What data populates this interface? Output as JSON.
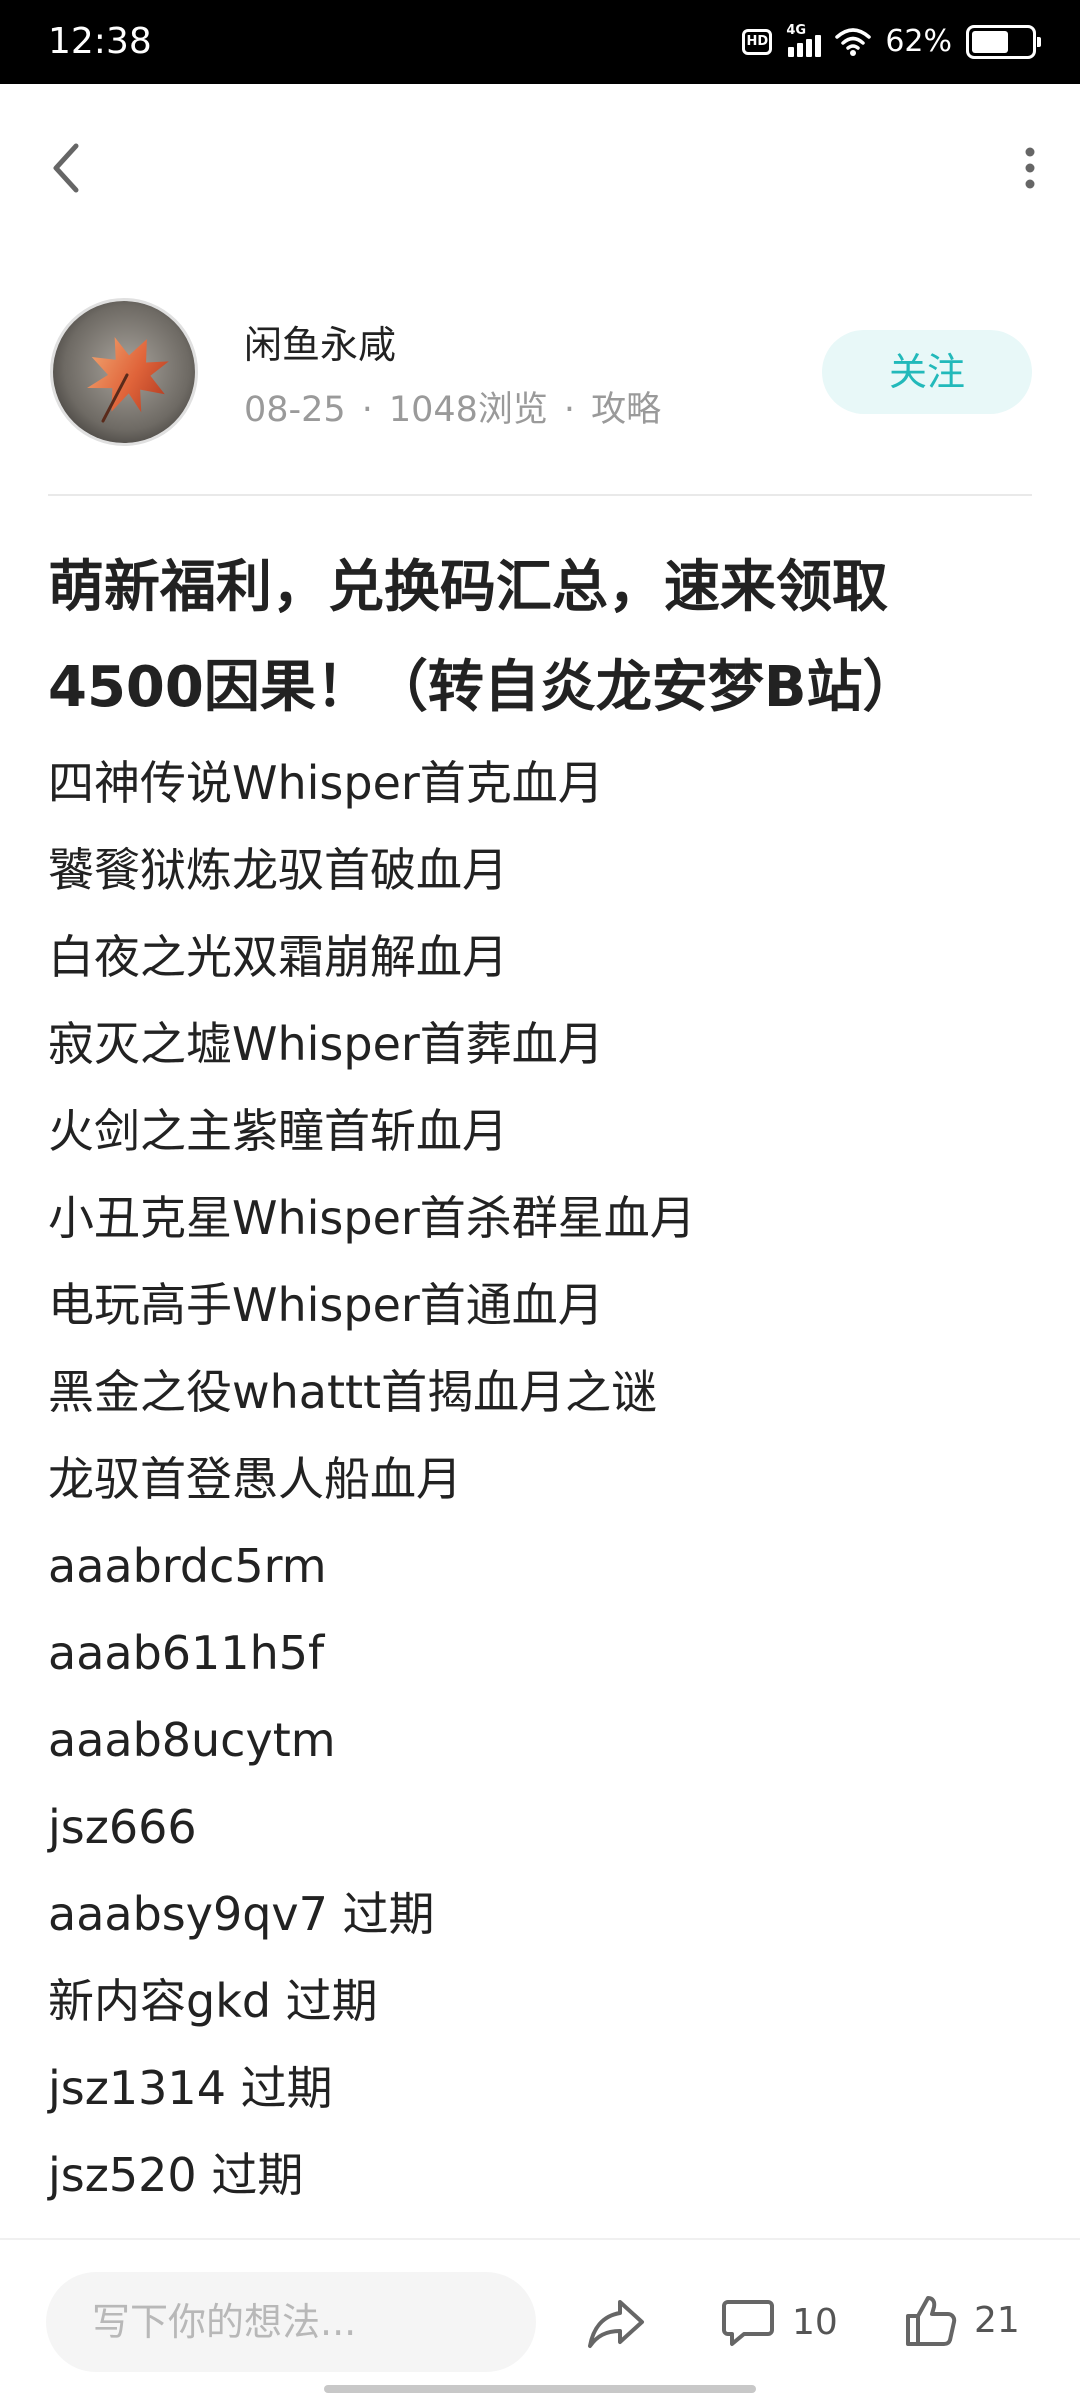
{
  "status_bar": {
    "time": "12:38",
    "hd": "HD",
    "network": "4G",
    "battery_percent": "62%",
    "battery_level": 0.62
  },
  "header": {
    "back_icon": "chevron-left-icon",
    "more_icon": "more-vertical-icon"
  },
  "author": {
    "name": "闲鱼永咸",
    "date": "08-25",
    "views": "1048浏览",
    "category": "攻略",
    "separator": "·",
    "follow_label": "关注"
  },
  "post": {
    "title": "萌新福利，兑换码汇总，速来领取4500因果！（转自炎龙安梦B站）",
    "lines": [
      "四神传说Whisper首克血月",
      "饕餮狱炼龙驭首破血月",
      "白夜之光双霜崩解血月",
      "寂灭之墟Whisper首葬血月",
      "火剑之主紫瞳首斩血月",
      "小丑克星Whisper首杀群星血月",
      "电玩高手Whisper首通血月",
      "黑金之役whattt首揭血月之谜",
      "龙驭首登愚人船血月",
      "aaabrdc5rm",
      "aaab611h5f",
      "aaab8ucytm",
      "jsz666",
      "aaabsy9qv7 过期",
      "新内容gkd 过期",
      "jsz1314 过期",
      "jsz520 过期"
    ]
  },
  "bottom_bar": {
    "comment_placeholder": "写下你的想法...",
    "comment_count": "10",
    "like_count": "21"
  },
  "colors": {
    "accent": "#22b9ba",
    "follow_bg": "#e8f8f8",
    "meta_text": "#9a9a9a"
  }
}
